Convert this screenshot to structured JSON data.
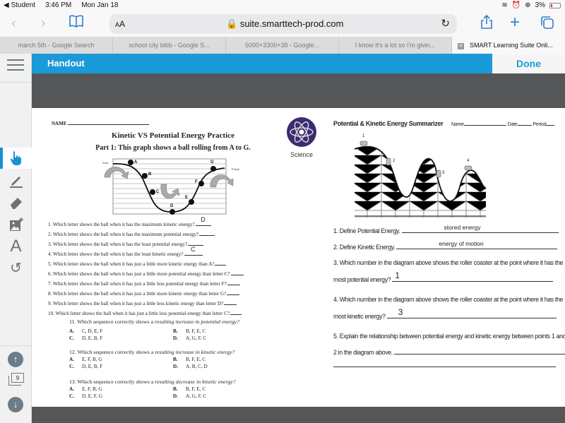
{
  "status_bar": {
    "back_app": "◀ Student",
    "time": "3:46 PM",
    "date": "Mon Jan 18",
    "battery": "3%"
  },
  "browser": {
    "text_size_label": "AA",
    "url": "suite.smarttech-prod.com",
    "tabs": [
      {
        "label": "march 5th - Google Search",
        "active": false
      },
      {
        "label": "school city bibb - Google S...",
        "active": false
      },
      {
        "label": "5000+3300+38 - Google...",
        "active": false
      },
      {
        "label": "I know it's a lot so I'm givin...",
        "active": false
      },
      {
        "label": "SMART Learning Suite Onli...",
        "active": true
      }
    ]
  },
  "app": {
    "header_title": "Handout",
    "done_label": "Done",
    "accent_color": "#1b9ad8",
    "tools": [
      {
        "name": "select-tool",
        "icon": "pointer-hand-icon",
        "active": true
      },
      {
        "name": "pen-tool",
        "icon": "pencil-icon",
        "active": false
      },
      {
        "name": "eraser-tool",
        "icon": "eraser-icon",
        "active": false
      },
      {
        "name": "add-image-tool",
        "icon": "add-image-icon",
        "active": false
      },
      {
        "name": "text-tool",
        "icon": "text-a-icon",
        "active": false
      },
      {
        "name": "undo-tool",
        "icon": "undo-icon",
        "active": false
      }
    ],
    "pager": {
      "page_count": "9"
    }
  },
  "worksheet_left": {
    "name_label": "NAME",
    "title": "Kinetic VS Potential Energy Practice",
    "subtitle": "Part 1: This graph shows a ball rolling from A to G.",
    "logo_label": "Science",
    "diagram": {
      "start_label": "Start",
      "finish_label": "Finish",
      "points": [
        "A",
        "B",
        "C",
        "D",
        "E",
        "F",
        "G"
      ]
    },
    "questions": [
      {
        "text": "1. Which letter shows the ball when it has the maximum kinetic energy?",
        "answer": "D"
      },
      {
        "text": "2. Which letter shows the ball when it has the maximum potential energy?",
        "answer": ""
      },
      {
        "text": "3. Which letter shows the ball when it has the least potential energy?",
        "answer": ""
      },
      {
        "text": "4. Which letter shows the ball when it has the least kinetic energy?",
        "answer": "C"
      },
      {
        "text": "5. Which letter shows the ball when it has just a little more kinetic energy than A?",
        "answer": ""
      },
      {
        "text": "6. Which letter shows the ball when it has just a little more potential energy than letter C?",
        "answer": ""
      },
      {
        "text": "7. Which letter shows the ball when it has just a little less potential energy than letter F?",
        "answer": ""
      },
      {
        "text": "8. Which letter shows the ball when it has just a little more kinetic energy than letter G?",
        "answer": ""
      },
      {
        "text": "9. Which letter shows the ball when it has just a little less kinetic energy than letter D?",
        "answer": ""
      },
      {
        "text": "10. Which letter shows the ball when it has just a little less potential energy than letter C?",
        "answer": ""
      }
    ],
    "multiple_choice": [
      {
        "prefix": "11. Which sequence correctly shows a ",
        "emphasis": "resulting increase in potential energy",
        "suffix": "?",
        "options": [
          {
            "letter": "A.",
            "text": "C, D, E, F"
          },
          {
            "letter": "B.",
            "text": "B, F, E, C"
          },
          {
            "letter": "C.",
            "text": "D, E, B, F"
          },
          {
            "letter": "D.",
            "text": "A, G, F, C"
          }
        ]
      },
      {
        "prefix": "12. Which sequence correctly shows a ",
        "emphasis": "resulting increase in kinetic energy",
        "suffix": "?",
        "options": [
          {
            "letter": "A.",
            "text": "E, F, B, G"
          },
          {
            "letter": "B.",
            "text": "B, F, E, C"
          },
          {
            "letter": "C.",
            "text": "D, E, B, F"
          },
          {
            "letter": "D.",
            "text": "A, B, C, D"
          }
        ]
      },
      {
        "prefix": "13. Which sequence correctly shows a ",
        "emphasis": "resulting decrease in kinetic energy",
        "suffix": "?",
        "options": [
          {
            "letter": "A.",
            "text": "E, F, B, G"
          },
          {
            "letter": "B.",
            "text": "B, F, E, C"
          },
          {
            "letter": "C.",
            "text": "D, E, F, G"
          },
          {
            "letter": "D.",
            "text": "A, G, F, C"
          }
        ]
      }
    ]
  },
  "worksheet_right": {
    "title": "Potential & Kinetic Energy Summarizer",
    "name_label": "Name",
    "date_label": "Date",
    "period_label": "Period",
    "coaster_points": [
      "1",
      "2",
      "3",
      "4"
    ],
    "questions": [
      {
        "text": "1. Define Potential Energy.",
        "answer": "stored energy"
      },
      {
        "text": "2. Define Kinetic Energy.",
        "answer": "energy of motion"
      },
      {
        "line1": "3. Which number in the diagram above shows the roller coaster at the point where it has the",
        "line2": "most potential energy?",
        "answer": "1"
      },
      {
        "line1": "4. Which number in the diagram above shows the roller coaster at the point where it has the",
        "line2": "most kinetic energy?",
        "answer": "3"
      },
      {
        "line1": "5. Explain the relationship between potential energy and kinetic energy between points 1 and",
        "line2": "2 in the diagram above.",
        "answer": ""
      }
    ]
  }
}
